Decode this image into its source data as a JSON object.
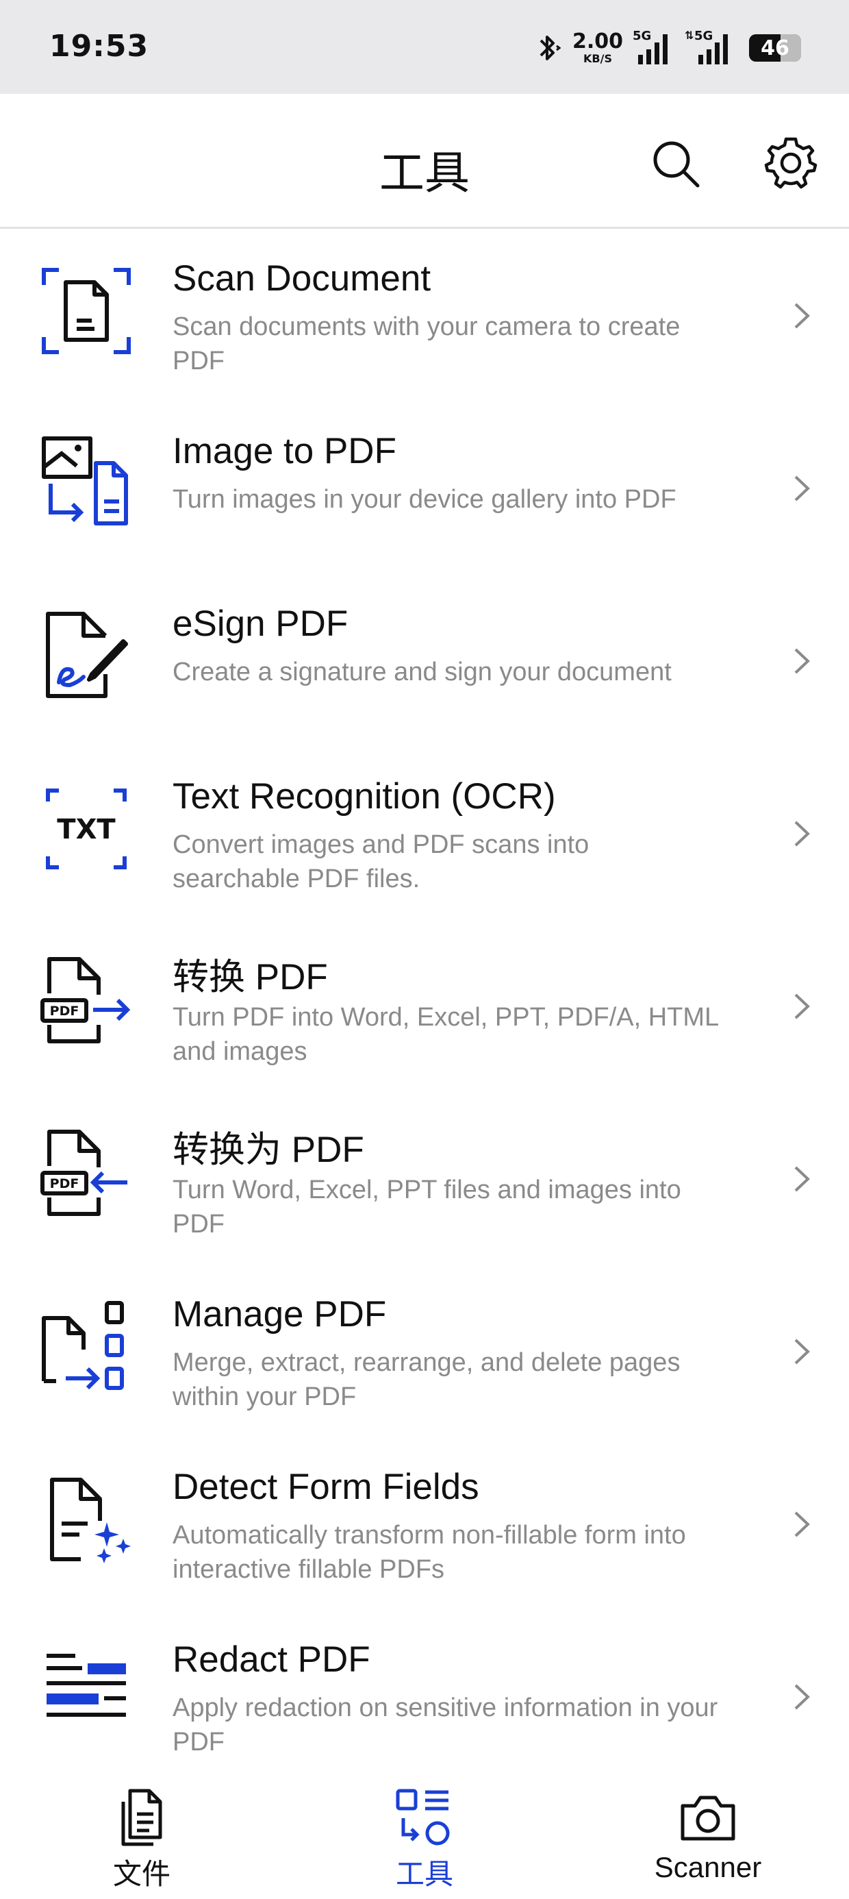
{
  "status_bar": {
    "time": "19:53",
    "net_speed_value": "2.00",
    "net_speed_unit": "KB/S",
    "signal_1_label": "5G",
    "signal_2_label": "5G",
    "battery": "46"
  },
  "header": {
    "title": "工具",
    "search_icon": "search-icon",
    "settings_icon": "gear-icon"
  },
  "tools": [
    {
      "title": "Scan Document",
      "desc": "Scan documents with your camera to create PDF",
      "icon": "scan-document-icon"
    },
    {
      "title": "Image to PDF",
      "desc": "Turn images in your device gallery into PDF",
      "icon": "image-to-pdf-icon"
    },
    {
      "title": "eSign PDF",
      "desc": "Create a signature and sign your document",
      "icon": "esign-icon"
    },
    {
      "title": "Text Recognition (OCR)",
      "desc": "Convert images and PDF scans into searchable PDF files.",
      "icon": "ocr-icon"
    },
    {
      "title": "转换 PDF",
      "desc": "Turn PDF into Word, Excel, PPT, PDF/A, HTML and images",
      "icon": "convert-pdf-icon"
    },
    {
      "title": "转换为 PDF",
      "desc": "Turn Word, Excel, PPT files and images into PDF",
      "icon": "convert-to-pdf-icon"
    },
    {
      "title": "Manage PDF",
      "desc": "Merge, extract, rearrange, and delete pages within your PDF",
      "icon": "manage-pdf-icon"
    },
    {
      "title": "Detect Form Fields",
      "desc": "Automatically transform non-fillable form into interactive fillable PDFs",
      "icon": "form-fields-icon"
    },
    {
      "title": "Redact PDF",
      "desc": "Apply redaction on sensitive information in your PDF",
      "icon": "redact-icon"
    }
  ],
  "bottom_nav": {
    "files_label": "文件",
    "tools_label": "工具",
    "scanner_label": "Scanner",
    "active": "tools"
  },
  "colors": {
    "accent": "#1a3fd6",
    "text_primary": "#111111",
    "text_secondary": "#8a8a8a",
    "status_bar_bg": "#e9e9eb"
  }
}
